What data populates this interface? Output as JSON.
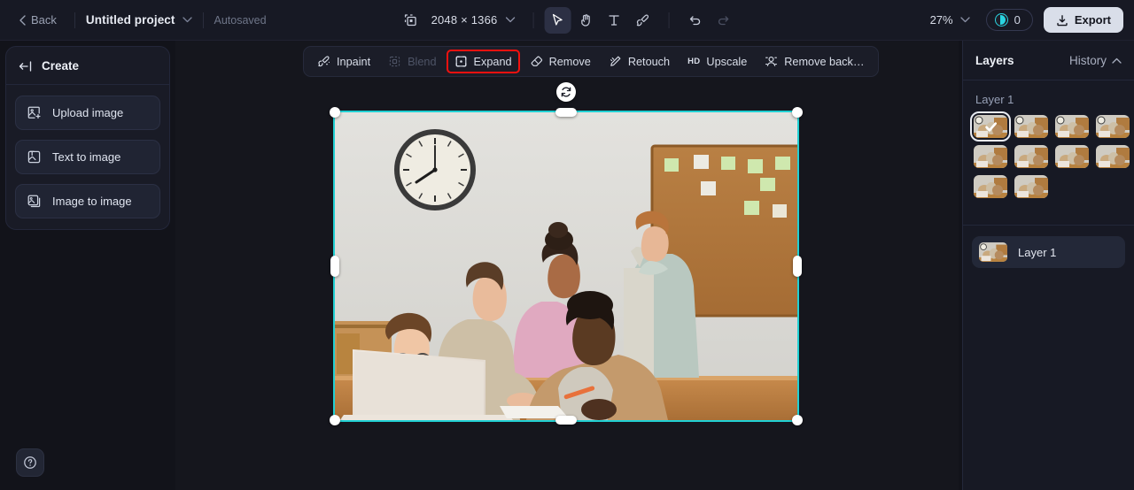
{
  "topbar": {
    "back_label": "Back",
    "project_name": "Untitled project",
    "autosaved_label": "Autosaved",
    "canvas_size": "2048 × 1366",
    "zoom_level": "27%",
    "credits_count": "0",
    "export_label": "Export",
    "tools": [
      {
        "name": "select-tool",
        "icon": "cursor-icon",
        "active": true
      },
      {
        "name": "hand-tool",
        "icon": "hand-icon",
        "active": false
      },
      {
        "name": "text-tool",
        "icon": "text-icon",
        "active": false
      },
      {
        "name": "brush-tool",
        "icon": "brush-icon",
        "active": false
      },
      {
        "name": "undo-tool",
        "icon": "undo-icon",
        "active": false
      },
      {
        "name": "redo-tool",
        "icon": "redo-icon",
        "active": false
      }
    ]
  },
  "sidebar": {
    "title": "Create",
    "collapse_icon": "collapse-left-icon",
    "items": [
      {
        "label": "Upload image",
        "icon": "upload-image-icon"
      },
      {
        "label": "Text to image",
        "icon": "text-to-image-icon"
      },
      {
        "label": "Image to image",
        "icon": "image-to-image-icon"
      }
    ]
  },
  "edit_toolbar": {
    "items": [
      {
        "label": "Inpaint",
        "icon": "inpaint-icon",
        "state": "normal"
      },
      {
        "label": "Blend",
        "icon": "blend-icon",
        "state": "disabled"
      },
      {
        "label": "Expand",
        "icon": "expand-icon",
        "state": "highlighted"
      },
      {
        "label": "Remove",
        "icon": "remove-icon",
        "state": "normal"
      },
      {
        "label": "Retouch",
        "icon": "retouch-icon",
        "state": "normal"
      },
      {
        "label": "Upscale",
        "icon": "hd-icon",
        "state": "normal"
      },
      {
        "label": "Remove back…",
        "icon": "remove-background-icon",
        "state": "normal"
      }
    ],
    "highlight_color": "#f2110f"
  },
  "canvas": {
    "selection_color": "#21d0d3",
    "background": "#15161d",
    "rotate_handle_icon": "rotate-icon",
    "image_description": "Five smiling colleagues gathered around a laptop in an office with a wall clock and a corkboard of sticky notes"
  },
  "right_panel": {
    "layers_tab": "Layers",
    "history_tab": "History",
    "history_chevron": "chevron-up-icon",
    "section_title": "Layer 1",
    "thumbnail_count": 10,
    "selected_thumbnail_index": 0,
    "selected_check_icon": "check-icon",
    "layer_rows": [
      {
        "name": "Layer 1"
      }
    ]
  },
  "help": {
    "icon": "question-circle-icon",
    "label": "Help"
  }
}
